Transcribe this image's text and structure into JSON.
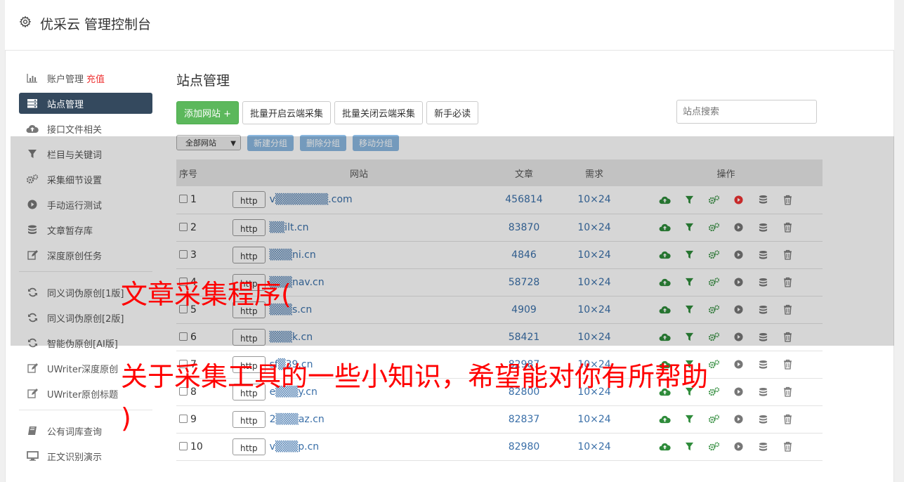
{
  "header": {
    "title": "优采云 管理控制台"
  },
  "sidebar": {
    "items": [
      {
        "label": "账户管理",
        "extra": "充值",
        "icon": "bar-chart-icon"
      },
      {
        "label": "站点管理",
        "icon": "server-icon",
        "active": true
      },
      {
        "label": "接口文件相关",
        "icon": "cloud-upload-icon"
      },
      {
        "label": "栏目与关键词",
        "icon": "filter-icon"
      },
      {
        "label": "采集细节设置",
        "icon": "cogs-icon"
      },
      {
        "label": "手动运行测试",
        "icon": "play-circle-icon"
      },
      {
        "label": "文章暂存库",
        "icon": "database-icon"
      },
      {
        "label": "深度原创任务",
        "icon": "edit-icon"
      }
    ],
    "items2": [
      {
        "label": "同义词伪原创[1版]",
        "icon": "refresh-icon"
      },
      {
        "label": "同义词伪原创[2版]",
        "icon": "refresh-icon"
      },
      {
        "label": "智能伪原创[AI版]",
        "icon": "refresh-icon"
      },
      {
        "label": "UWriter深度原创",
        "icon": "edit-icon"
      },
      {
        "label": "UWriter原创标题",
        "icon": "edit-icon"
      }
    ],
    "items3": [
      {
        "label": "公有词库查询",
        "icon": "book-icon"
      },
      {
        "label": "正文识别演示",
        "icon": "monitor-icon"
      }
    ]
  },
  "main": {
    "title": "站点管理",
    "buttons": {
      "add": "添加网站 +",
      "batch_on": "批量开启云端采集",
      "batch_off": "批量关闭云端采集",
      "guide": "新手必读"
    },
    "search_placeholder": "站点搜索",
    "group_select": "全部网站",
    "group_buttons": {
      "new": "新建分组",
      "delete": "删除分组",
      "move": "移动分组"
    },
    "columns": {
      "no": "序号",
      "site": "网站",
      "articles": "文章",
      "demand": "需求",
      "ops": "操作"
    },
    "http_label": "http",
    "rows": [
      {
        "no": "1",
        "site": "v▒▒▒▒▒▒▒.com",
        "articles": "456814",
        "demand": "10×24",
        "play_red": true
      },
      {
        "no": "2",
        "site": "▒▒ilt.cn",
        "articles": "83870",
        "demand": "10×24",
        "play_red": false
      },
      {
        "no": "3",
        "site": "▒▒▒ni.cn",
        "articles": "4846",
        "demand": "10×24",
        "play_red": false
      },
      {
        "no": "4",
        "site": "▒▒▒nav.cn",
        "articles": "58728",
        "demand": "10×24",
        "play_red": false
      },
      {
        "no": "5",
        "site": "▒▒▒s.cn",
        "articles": "4909",
        "demand": "10×24",
        "play_red": false
      },
      {
        "no": "6",
        "site": "▒▒▒k.cn",
        "articles": "58421",
        "demand": "10×24",
        "play_red": false
      },
      {
        "no": "7",
        "site": "sf▒39.cn",
        "articles": "82987",
        "demand": "10×24",
        "play_red": false
      },
      {
        "no": "8",
        "site": "e▒▒▒y.cn",
        "articles": "82800",
        "demand": "10×24",
        "play_red": false
      },
      {
        "no": "9",
        "site": "2▒▒▒az.cn",
        "articles": "82837",
        "demand": "10×24",
        "play_red": false
      },
      {
        "no": "10",
        "site": "v▒▒▒p.cn",
        "articles": "82980",
        "demand": "10×24",
        "play_red": false
      }
    ]
  },
  "overlay_text": {
    "line1": "文章采集程序(",
    "line2": "关于采集工具的一些小知识，希望能对你有所帮助",
    "line3": ")"
  },
  "colors": {
    "green": "#5cb85c",
    "sidebar_active": "#34495e",
    "link": "#3a6fa8",
    "overlay_red": "#ff0000"
  }
}
